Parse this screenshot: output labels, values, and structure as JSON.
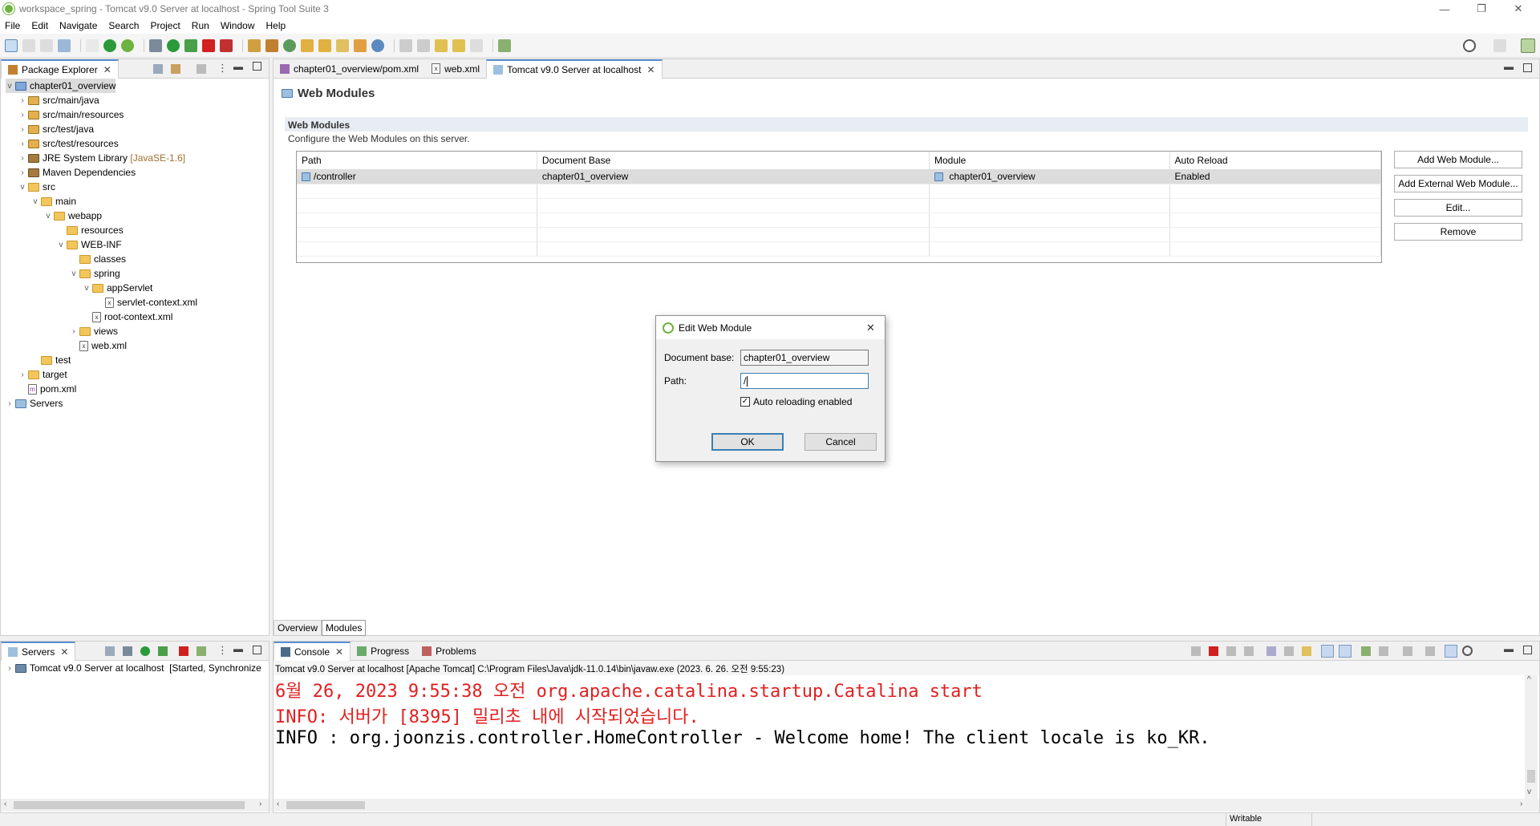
{
  "window": {
    "title": "workspace_spring - Tomcat v9.0 Server at localhost - Spring Tool Suite 3",
    "minimize": "—",
    "restore": "❐",
    "close": "✕"
  },
  "menu": [
    "File",
    "Edit",
    "Navigate",
    "Search",
    "Project",
    "Run",
    "Window",
    "Help"
  ],
  "package_explorer": {
    "tab_label": "Package Explorer",
    "items": [
      {
        "label": "chapter01_overview",
        "extra": ""
      },
      {
        "label": "src/main/java",
        "extra": ""
      },
      {
        "label": "src/main/resources",
        "extra": ""
      },
      {
        "label": "src/test/java",
        "extra": ""
      },
      {
        "label": "src/test/resources",
        "extra": ""
      },
      {
        "label": "JRE System Library",
        "extra": "[JavaSE-1.6]"
      },
      {
        "label": "Maven Dependencies",
        "extra": ""
      },
      {
        "label": "src",
        "extra": ""
      },
      {
        "label": "main",
        "extra": ""
      },
      {
        "label": "webapp",
        "extra": ""
      },
      {
        "label": "resources",
        "extra": ""
      },
      {
        "label": "WEB-INF",
        "extra": ""
      },
      {
        "label": "classes",
        "extra": ""
      },
      {
        "label": "spring",
        "extra": ""
      },
      {
        "label": "appServlet",
        "extra": ""
      },
      {
        "label": "servlet-context.xml",
        "extra": ""
      },
      {
        "label": "root-context.xml",
        "extra": ""
      },
      {
        "label": "views",
        "extra": ""
      },
      {
        "label": "web.xml",
        "extra": ""
      },
      {
        "label": "test",
        "extra": ""
      },
      {
        "label": "target",
        "extra": ""
      },
      {
        "label": "pom.xml",
        "extra": ""
      },
      {
        "label": "Servers",
        "extra": ""
      }
    ]
  },
  "editor": {
    "tabs": [
      "chapter01_overview/pom.xml",
      "web.xml",
      "Tomcat v9.0 Server at localhost"
    ],
    "page_title": "Web Modules",
    "section_title": "Web Modules",
    "section_desc": "Configure the Web Modules on this server.",
    "columns": [
      "Path",
      "Document Base",
      "Module",
      "Auto Reload"
    ],
    "rows": [
      [
        "/controller",
        "chapter01_overview",
        "chapter01_overview",
        "Enabled"
      ]
    ],
    "buttons": {
      "add": "Add Web Module...",
      "add_external": "Add External Web Module...",
      "edit": "Edit...",
      "remove": "Remove"
    },
    "bottom_tabs": [
      "Overview",
      "Modules"
    ]
  },
  "dialog": {
    "title": "Edit Web Module",
    "doc_base_label": "Document base:",
    "doc_base_value": "chapter01_overview",
    "path_label": "Path:",
    "path_value": "/",
    "auto_reload_label": "Auto reloading enabled",
    "auto_reload_checked": true,
    "ok": "OK",
    "cancel": "Cancel"
  },
  "servers_view": {
    "tab_label": "Servers",
    "item": "Tomcat v9.0 Server at localhost",
    "status": "[Started, Synchronize"
  },
  "console": {
    "tabs": [
      "Console",
      "Progress",
      "Problems"
    ],
    "header": "Tomcat v9.0 Server at localhost [Apache Tomcat] C:\\Program Files\\Java\\jdk-11.0.14\\bin\\javaw.exe  (2023. 6. 26. 오전 9:55:23)",
    "lines": [
      {
        "text": "6월 26, 2023 9:55:38 오전 org.apache.catalina.startup.Catalina start",
        "color": "#e02020"
      },
      {
        "text": "INFO: 서버가 [8395] 밀리초 내에 시작되었습니다.",
        "color": "#e02020"
      },
      {
        "text": "INFO : org.joonzis.controller.HomeController - Welcome home! The client locale is ko_KR.",
        "color": "#000000"
      }
    ]
  },
  "statusbar": {
    "mode": "Writable"
  }
}
